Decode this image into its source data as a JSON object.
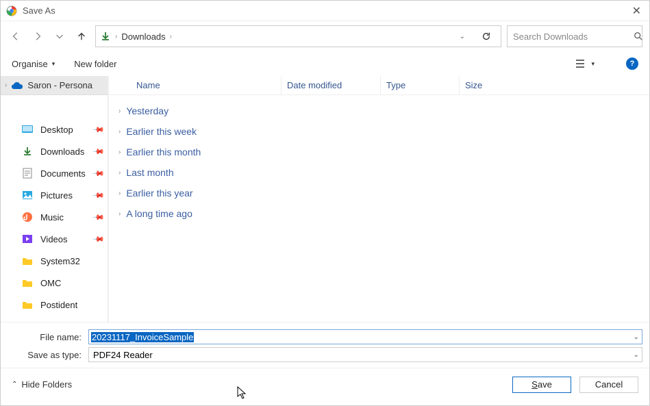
{
  "window": {
    "title": "Save As"
  },
  "breadcrumb": {
    "location": "Downloads"
  },
  "search": {
    "placeholder": "Search Downloads"
  },
  "toolbar": {
    "organise": "Organise",
    "new_folder": "New folder"
  },
  "sidebar": {
    "current": "Saron - Persona",
    "items": [
      {
        "label": "Desktop"
      },
      {
        "label": "Downloads"
      },
      {
        "label": "Documents"
      },
      {
        "label": "Pictures"
      },
      {
        "label": "Music"
      },
      {
        "label": "Videos"
      },
      {
        "label": "System32"
      },
      {
        "label": "OMC"
      },
      {
        "label": "Postident"
      }
    ]
  },
  "columns": {
    "name": "Name",
    "date": "Date modified",
    "type": "Type",
    "size": "Size"
  },
  "groups": [
    "Yesterday",
    "Earlier this week",
    "Earlier this month",
    "Last month",
    "Earlier this year",
    "A long time ago"
  ],
  "form": {
    "filename_label": "File name:",
    "filename_value": "20231117_InvoiceSample",
    "type_label": "Save as type:",
    "type_value": "PDF24 Reader"
  },
  "footer": {
    "hide": "Hide Folders",
    "save": "Save",
    "cancel": "Cancel"
  }
}
